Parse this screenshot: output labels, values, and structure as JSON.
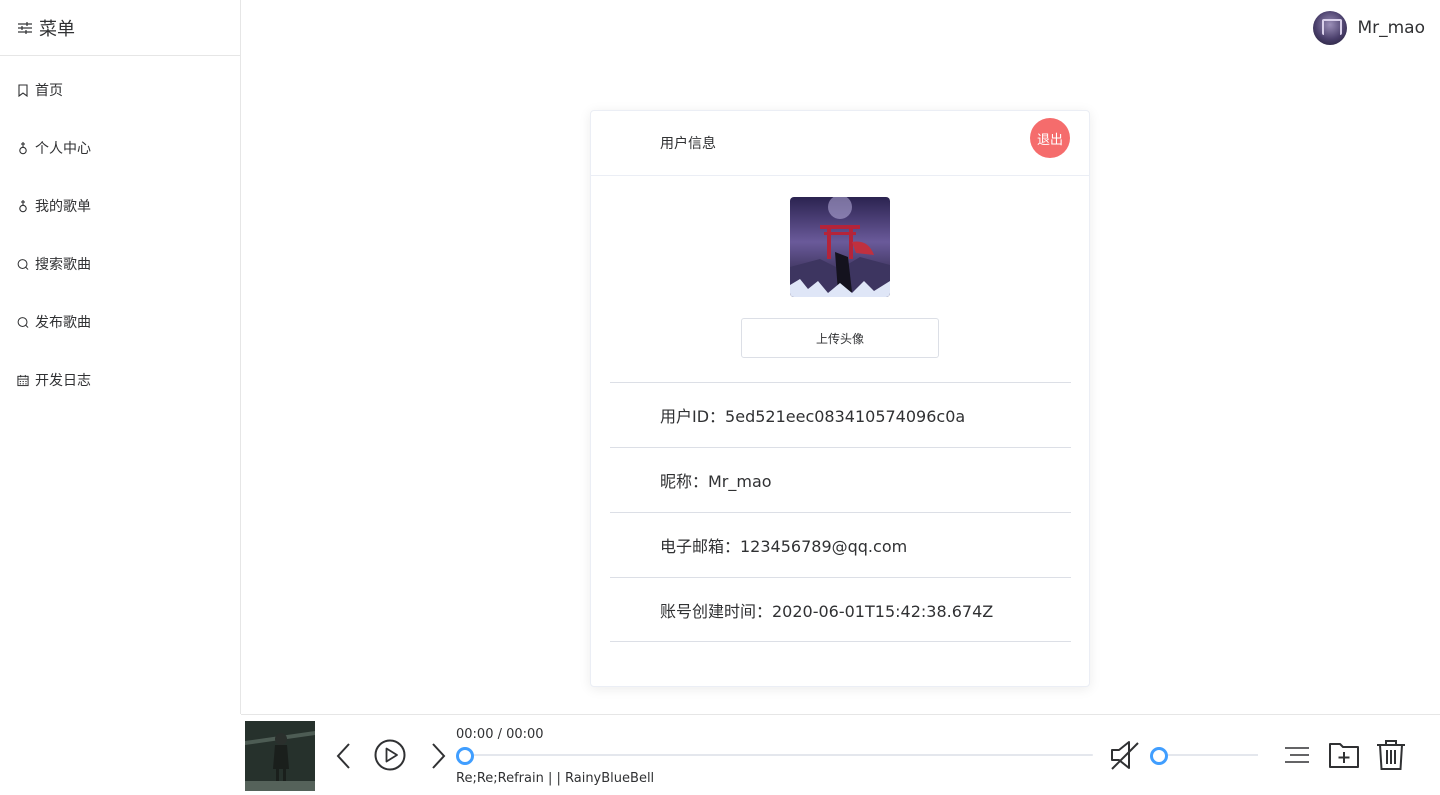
{
  "sidebar": {
    "title": "菜单",
    "items": [
      {
        "label": "首页",
        "icon": "bookmark-icon"
      },
      {
        "label": "个人中心",
        "icon": "female-icon"
      },
      {
        "label": "我的歌单",
        "icon": "female-icon"
      },
      {
        "label": "搜索歌曲",
        "icon": "search-icon"
      },
      {
        "label": "发布歌曲",
        "icon": "search-icon"
      },
      {
        "label": "开发日志",
        "icon": "calendar-icon"
      }
    ]
  },
  "header": {
    "username": "Mr_mao"
  },
  "card": {
    "title": "用户信息",
    "logout_label": "退出",
    "upload_label": "上传头像",
    "rows": {
      "user_id": "用户ID：5ed521eec083410574096c0a",
      "nickname": "昵称：Mr_mao",
      "email": "电子邮箱：123456789@qq.com",
      "created": "账号创建时间：2020-06-01T15:42:38.674Z"
    }
  },
  "player": {
    "time": "00:00 / 00:00",
    "song": "Re;Re;Refrain | | RainyBlueBell",
    "progress_fraction": 0,
    "volume_fraction": 0,
    "icons": [
      "prev-icon",
      "play-icon",
      "next-icon",
      "mute-icon",
      "playlist-icon",
      "add-folder-icon",
      "trash-icon"
    ]
  },
  "colors": {
    "accent": "#409eff",
    "danger": "#f56c6c",
    "border": "#e6e6e6"
  }
}
